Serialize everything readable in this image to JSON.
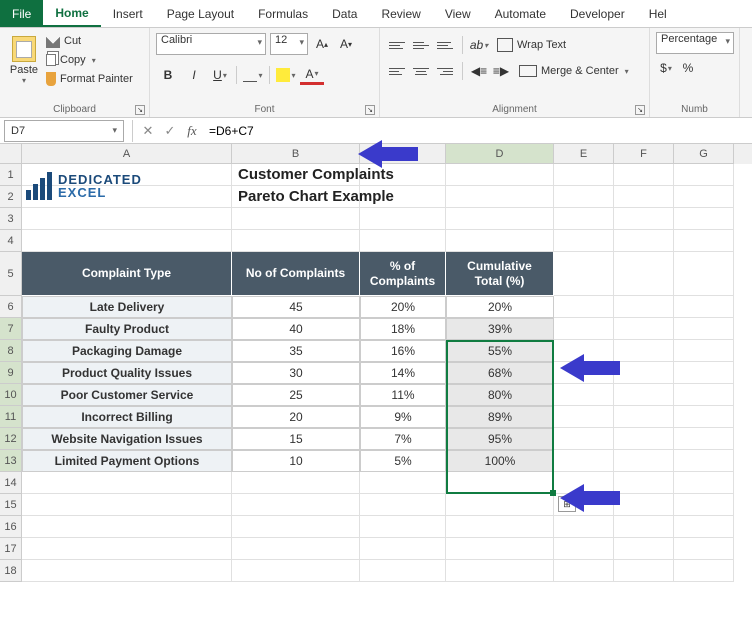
{
  "tabs": {
    "file": "File",
    "home": "Home",
    "insert": "Insert",
    "page_layout": "Page Layout",
    "formulas": "Formulas",
    "data": "Data",
    "review": "Review",
    "view": "View",
    "automate": "Automate",
    "developer": "Developer",
    "help": "Hel"
  },
  "clipboard": {
    "paste": "Paste",
    "cut": "Cut",
    "copy": "Copy",
    "format_painter": "Format Painter",
    "label": "Clipboard"
  },
  "font": {
    "name": "Calibri",
    "size": "12",
    "label": "Font"
  },
  "alignment": {
    "wrap": "Wrap Text",
    "merge": "Merge & Center",
    "label": "Alignment"
  },
  "number": {
    "format": "Percentage",
    "label": "Numb"
  },
  "formula_bar": {
    "cell_ref": "D7",
    "formula": "=D6+C7"
  },
  "title1": "Customer Complaints",
  "title2": "Pareto Chart Example",
  "logo": {
    "top": "DEDICATED",
    "bottom": "EXCEL"
  },
  "headers": {
    "a": "Complaint Type",
    "b": "No of Complaints",
    "c": "% of Complaints",
    "d": "Cumulative Total (%)"
  },
  "rows": [
    {
      "type": "Late Delivery",
      "count": "45",
      "pct": "20%",
      "cum": "20%"
    },
    {
      "type": "Faulty Product",
      "count": "40",
      "pct": "18%",
      "cum": "39%"
    },
    {
      "type": "Packaging Damage",
      "count": "35",
      "pct": "16%",
      "cum": "55%"
    },
    {
      "type": "Product Quality Issues",
      "count": "30",
      "pct": "14%",
      "cum": "68%"
    },
    {
      "type": "Poor Customer Service",
      "count": "25",
      "pct": "11%",
      "cum": "80%"
    },
    {
      "type": "Incorrect Billing",
      "count": "20",
      "pct": "9%",
      "cum": "89%"
    },
    {
      "type": "Website Navigation Issues",
      "count": "15",
      "pct": "7%",
      "cum": "95%"
    },
    {
      "type": "Limited Payment Options",
      "count": "10",
      "pct": "5%",
      "cum": "100%"
    }
  ],
  "cols": [
    "A",
    "B",
    "C",
    "D",
    "E",
    "F",
    "G"
  ],
  "chart_data": {
    "type": "table",
    "title": "Customer Complaints Pareto Chart Example",
    "columns": [
      "Complaint Type",
      "No of Complaints",
      "% of Complaints",
      "Cumulative Total (%)"
    ],
    "data": [
      [
        "Late Delivery",
        45,
        20,
        20
      ],
      [
        "Faulty Product",
        40,
        18,
        39
      ],
      [
        "Packaging Damage",
        35,
        16,
        55
      ],
      [
        "Product Quality Issues",
        30,
        14,
        68
      ],
      [
        "Poor Customer Service",
        25,
        11,
        80
      ],
      [
        "Incorrect Billing",
        20,
        9,
        89
      ],
      [
        "Website Navigation Issues",
        15,
        7,
        95
      ],
      [
        "Limited Payment Options",
        10,
        5,
        100
      ]
    ]
  }
}
